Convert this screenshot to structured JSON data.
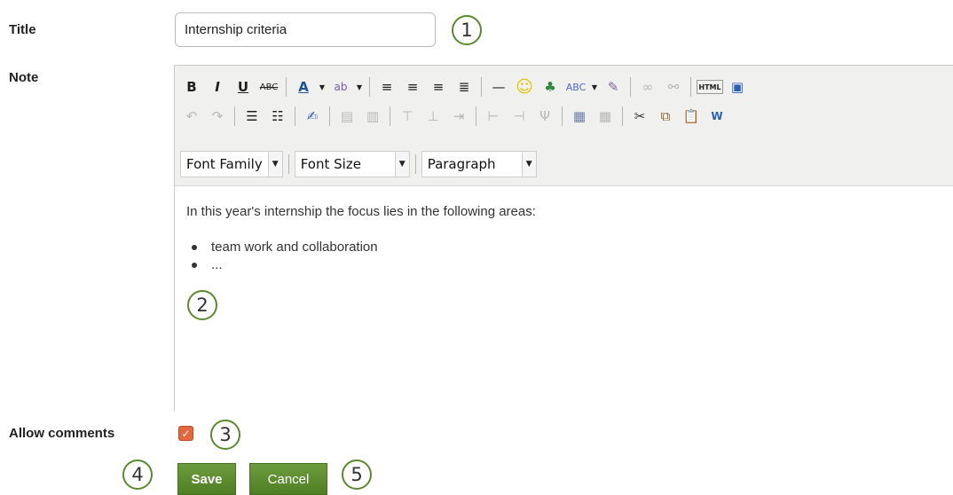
{
  "form": {
    "title_label": "Title",
    "title_value": "Internship criteria",
    "note_label": "Note",
    "allow_comments_label": "Allow comments",
    "allow_comments_checked": true,
    "save_label": "Save",
    "cancel_label": "Cancel"
  },
  "editor": {
    "font_family": "Font Family",
    "font_size": "Font Size",
    "format": "Paragraph",
    "content": {
      "paragraph": "In this year's internship the focus lies in the following areas:",
      "bullets": [
        "team work and collaboration",
        "..."
      ]
    }
  },
  "callouts": [
    "1",
    "2",
    "3",
    "4",
    "5"
  ],
  "toolbar_icons_row1": [
    "bold-icon",
    "italic-icon",
    "underline-icon",
    "strikethrough-icon",
    "text-color-icon",
    "highlight-color-icon",
    "align-left-icon",
    "align-center-icon",
    "align-right-icon",
    "justify-icon",
    "horizontal-rule-icon",
    "emoticon-icon",
    "image-icon",
    "spellcheck-icon",
    "cleanup-icon",
    "link-icon",
    "unlink-icon",
    "html-source-icon",
    "fullscreen-icon"
  ],
  "toolbar_icons_row2": [
    "undo-icon",
    "redo-icon",
    "bullet-list-icon",
    "numbered-list-icon",
    "edit-icon",
    "table-row-icon",
    "table-col-icon",
    "insert-row-before-icon",
    "insert-row-after-icon",
    "delete-row-icon",
    "insert-col-before-icon",
    "insert-col-after-icon",
    "delete-col-icon",
    "table-icon",
    "table-props-icon",
    "cut-icon",
    "copy-icon",
    "paste-icon",
    "paste-word-icon"
  ],
  "colors": {
    "accent_green": "#5b8a2e",
    "button_green": "#5a8a2e",
    "checkbox_orange": "#e4683c"
  }
}
